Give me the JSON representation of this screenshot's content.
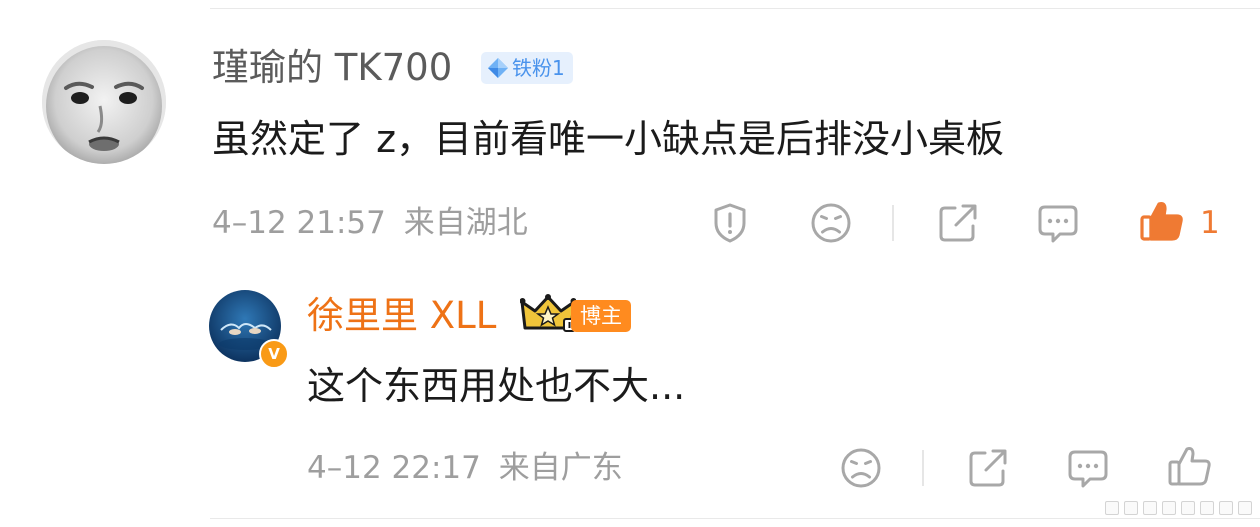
{
  "colors": {
    "author_name": "#5b5b5b",
    "body_text": "#1b1b1b",
    "meta_text": "#9e9e9e",
    "icon_gray": "#a8a8a8",
    "like_orange": "#ef7a33",
    "blogger_name": "#ee7216",
    "fan_badge_bg": "#e6f0fd",
    "fan_badge_text": "#4a93ec",
    "blogger_badge_bg": "#ff8b1f"
  },
  "comment": {
    "author": "瑾瑜的 TK700",
    "badge": {
      "icon": "diamond-icon",
      "label": "铁粉1"
    },
    "text": "虽然定了 z，目前看唯一小缺点是后排没小桌板",
    "time": "4–12 21:57",
    "location": "来自湖北",
    "actions": {
      "report_icon": "report-icon",
      "dislike_icon": "frown-icon",
      "share_icon": "share-icon",
      "reply_icon": "comment-icon",
      "like_icon": "like-icon",
      "like_count": "1"
    }
  },
  "reply": {
    "author": "徐里里 XLL",
    "crown_icon": "crown-icon",
    "verified_mark": "V",
    "badge_label": "博主",
    "text": "这个东西用处也不大...",
    "time": "4–12 22:17",
    "location": "来自广东",
    "actions": {
      "dislike_icon": "frown-icon",
      "share_icon": "share-icon",
      "reply_icon": "comment-icon",
      "like_icon": "like-icon"
    }
  }
}
